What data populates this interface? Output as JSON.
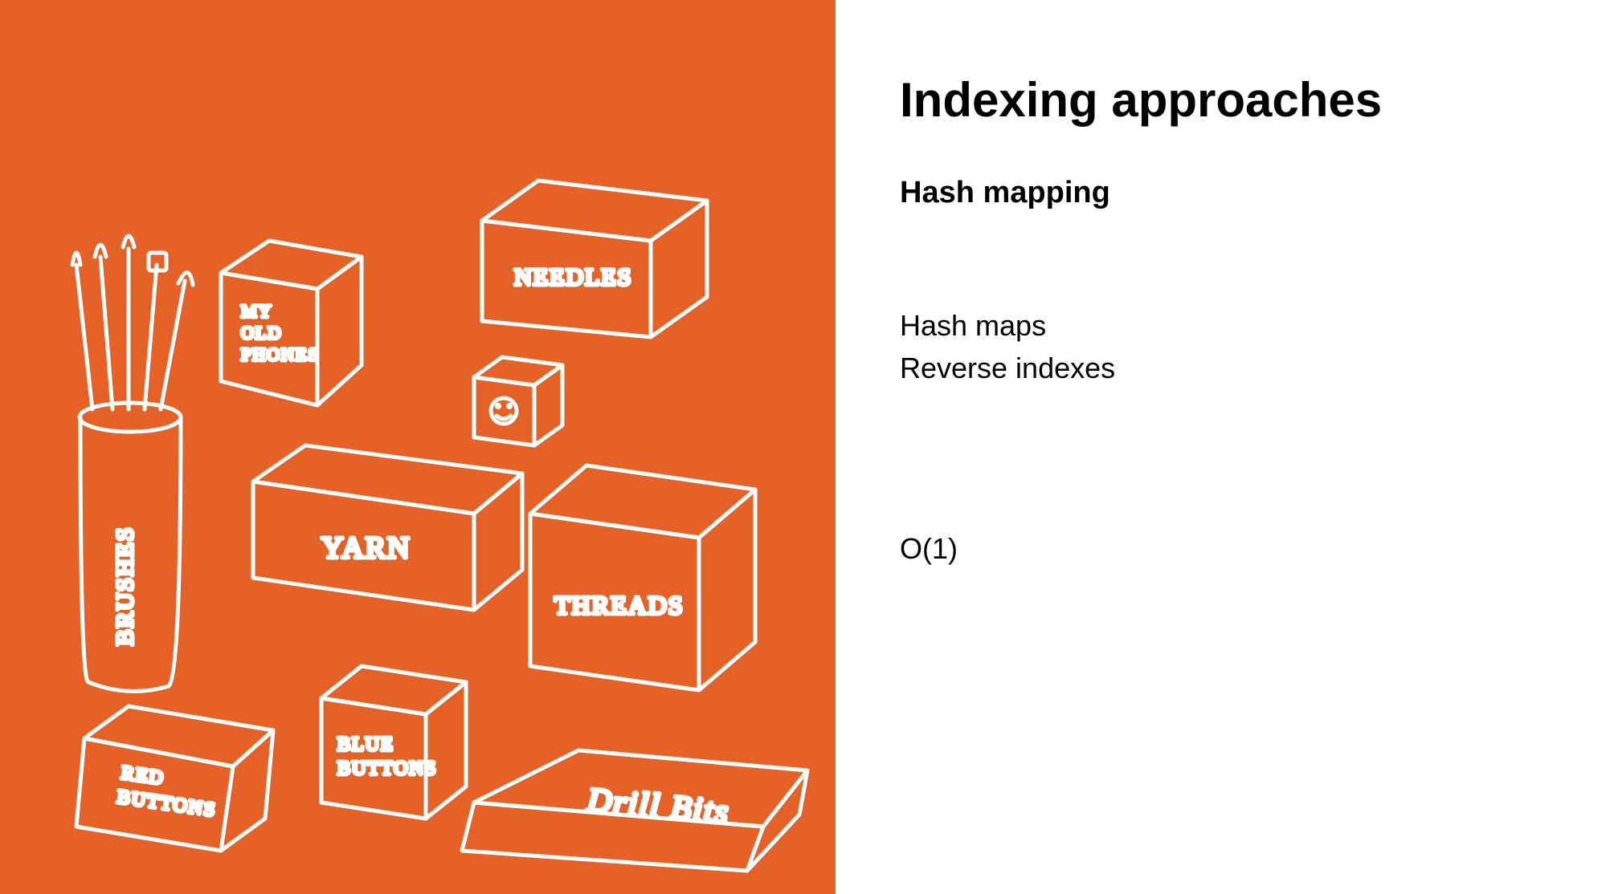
{
  "slide": {
    "title": "Indexing approaches",
    "subtitle": "Hash mapping",
    "body_line1": "Hash maps",
    "body_line2": "Reverse indexes",
    "complexity": "O(1)"
  },
  "illustration": {
    "description": "hand-drawn labeled boxes illustration",
    "labels": {
      "brushes": "BRUSHES",
      "my_old_phones_l1": "MY",
      "my_old_phones_l2": "OLD",
      "my_old_phones_l3": "PHONES",
      "needles": "NEEDLES",
      "yarn": "YARN",
      "threads": "THREADS",
      "blue_buttons_l1": "BLUE",
      "blue_buttons_l2": "BUTTONS",
      "red_buttons_l1": "RED",
      "red_buttons_l2": "BUTTONS",
      "drill_bits": "Drill Bits",
      "smiley": "☺"
    }
  },
  "colors": {
    "accent": "#e46127",
    "stroke": "#ffffff",
    "text": "#000000"
  }
}
